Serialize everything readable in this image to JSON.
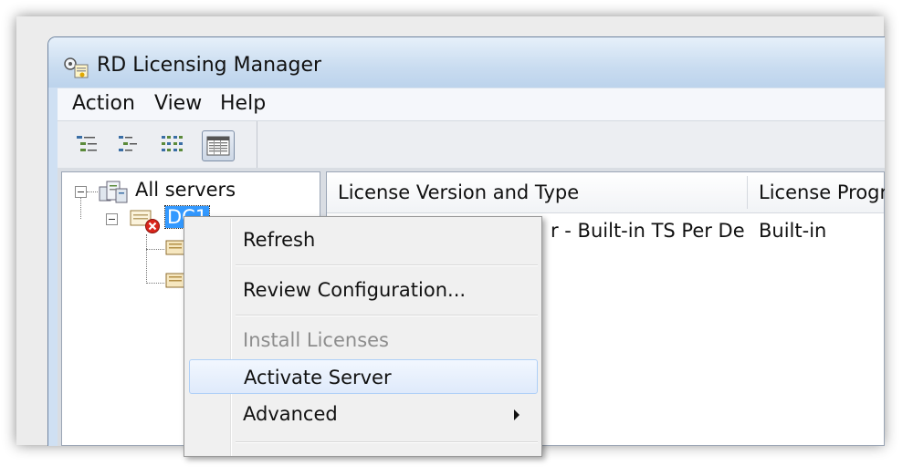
{
  "window": {
    "title": "RD Licensing Manager"
  },
  "menubar": {
    "items": [
      "Action",
      "View",
      "Help"
    ]
  },
  "toolbar": {
    "buttons": [
      "tree-view-icon",
      "list-tree-icon",
      "details-grid-icon",
      "table-view-icon"
    ]
  },
  "tree": {
    "root_label": "All servers",
    "server_label": "DC1"
  },
  "list": {
    "columns": [
      "License Version and Type",
      "License Progra"
    ],
    "rows": [
      {
        "type": "r - Built-in TS Per De...",
        "program": "Built-in"
      }
    ]
  },
  "context_menu": {
    "items": [
      {
        "label": "Refresh",
        "enabled": true
      },
      {
        "label": "Review Configuration...",
        "enabled": true
      },
      {
        "label": "Install Licenses",
        "enabled": false
      },
      {
        "label": "Activate Server",
        "enabled": true,
        "highlighted": true
      },
      {
        "label": "Advanced",
        "enabled": true,
        "submenu": true
      }
    ]
  },
  "colors": {
    "selection": "#3399ff",
    "error": "#d9261c",
    "menu_highlight": "#dfeafb"
  }
}
